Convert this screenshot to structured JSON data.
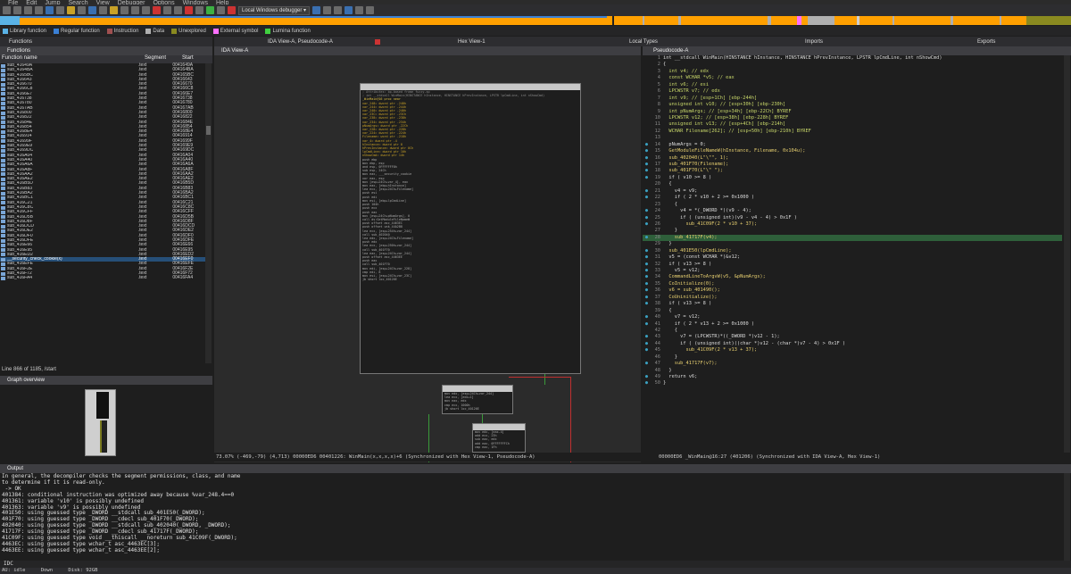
{
  "menu": [
    "File",
    "Edit",
    "Jump",
    "Search",
    "View",
    "Debugger",
    "Options",
    "Windows",
    "Help"
  ],
  "toolbar": {
    "debugger_select": "Local Windows debugger"
  },
  "legend": [
    {
      "label": "Library function",
      "color": "#5ab3e6"
    },
    {
      "label": "Regular function",
      "color": "#3a7fd5"
    },
    {
      "label": "Instruction",
      "color": "#a05050"
    },
    {
      "label": "Data",
      "color": "#b0b0b0"
    },
    {
      "label": "Unexplored",
      "color": "#8a8a20"
    },
    {
      "label": "External symbol",
      "color": "#ff70ff"
    },
    {
      "label": "Lumina function",
      "color": "#40d040"
    }
  ],
  "tabs": {
    "functions": "Functions",
    "ida_pseudo": "IDA View-A, Pseudocode-A",
    "hex": "Hex View-1",
    "local_types": "Local Types",
    "imports": "Imports",
    "exports": "Exports"
  },
  "panes": {
    "ida_view": "IDA View-A",
    "pseudocode": "Pseudocode-A",
    "graph_overview": "Graph overview",
    "output": "Output"
  },
  "functions": {
    "columns": [
      "Function name",
      "Segment",
      "Start"
    ],
    "rows": [
      [
        "sub_41649A",
        ".text",
        "0041649A"
      ],
      [
        "sub_4164BA",
        ".text",
        "004164BA"
      ],
      [
        "sub_4165BC",
        ".text",
        "004165BC"
      ],
      [
        "sub_416643",
        ".text",
        "00416643"
      ],
      [
        "sub_416670",
        ".text",
        "00416670"
      ],
      [
        "sub_4166C8",
        ".text",
        "004166C8"
      ],
      [
        "sub_4166E7",
        ".text",
        "004166E7"
      ],
      [
        "sub_416738",
        ".text",
        "00416738"
      ],
      [
        "sub_416780",
        ".text",
        "00416780"
      ],
      [
        "sub_4167AB",
        ".text",
        "004167AB"
      ],
      [
        "sub_416800",
        ".text",
        "00416800"
      ],
      [
        "sub_416822",
        ".text",
        "00416822"
      ],
      [
        "sub_41684E",
        ".text",
        "0041684E"
      ],
      [
        "sub_416854",
        ".text",
        "00416854"
      ],
      [
        "sub_4168E4",
        ".text",
        "004168E4"
      ],
      [
        "sub_416914",
        ".text",
        "00416914"
      ],
      [
        "sub_41699F",
        ".text",
        "0041699F"
      ],
      [
        "sub_4169E9",
        ".text",
        "004169E9"
      ],
      [
        "sub_4169DC",
        ".text",
        "004169DC"
      ],
      [
        "sub_416A04",
        ".text",
        "00416A04"
      ],
      [
        "sub_416A40",
        ".text",
        "00416A40"
      ],
      [
        "sub_416A6A",
        ".text",
        "00416A6A"
      ],
      [
        "sub_416A8F",
        ".text",
        "00416A8F"
      ],
      [
        "sub_416AA2",
        ".text",
        "00416AA2"
      ],
      [
        "sub_416AE2",
        ".text",
        "00416AE2"
      ],
      [
        "sub_416B5D",
        ".text",
        "00416B5D"
      ],
      [
        "sub_416B83",
        ".text",
        "00416B83"
      ],
      [
        "sub_416BA2",
        ".text",
        "00416BA2"
      ],
      [
        "sub_416BC1",
        ".text",
        "00416BC1"
      ],
      [
        "sub_416C21",
        ".text",
        "00416C21"
      ],
      [
        "sub_416C8C",
        ".text",
        "00416C8C"
      ],
      [
        "sub_416CFF",
        ".text",
        "00416CFF"
      ],
      [
        "sub_416D5B",
        ".text",
        "00416D5B"
      ],
      [
        "sub_416D8F",
        ".text",
        "00416D8F"
      ],
      [
        "sub_416DCD",
        ".text",
        "00416DCD"
      ],
      [
        "sub_416DE2",
        ".text",
        "00416DE2"
      ],
      [
        "sub_416DF0",
        ".text",
        "00416DF0"
      ],
      [
        "sub_416DFE",
        ".text",
        "00416DFE"
      ],
      [
        "sub_416E66",
        ".text",
        "00416E66"
      ],
      [
        "sub_416E95",
        ".text",
        "00416E95"
      ],
      [
        "sub_416ED2",
        ".text",
        "00416ED2"
      ],
      [
        "__security_check_cookie(x)",
        ".text",
        "00416EF0"
      ],
      [
        "sub_416EFE",
        ".text",
        "00416EFE"
      ],
      [
        "sub_416F2E",
        ".text",
        "00416F2E"
      ],
      [
        "sub_416F72",
        ".text",
        "00416F72"
      ],
      [
        "sub_416FA4",
        ".text",
        "00416FA4"
      ]
    ],
    "selected_index": 41
  },
  "line_info": "Line 866 of 1185, /start",
  "ida_status": "73.07% (-469,-79) (4,713) 00000ED6 00401226: WinMain(x,x,x,x)+6 (Synchronized with Hex View-1, Pseudocode-A)",
  "asm_main_block": [
    "; Attributes: bp-based frame fuzzy-sp",
    "",
    "; int __stdcall WinMain(HINSTANCE hInstance, HINSTANCE hPrevInstance, LPSTR lpCmdLine, int nShowCmd)",
    "_WinMain@16 proc near",
    "",
    "var_248= dword ptr -248h",
    "var_244= dword ptr -244h",
    "var_240= dword ptr -240h",
    "var_23C= dword ptr -23Ch",
    "var_238= dword ptr -238h",
    "var_234= dword ptr -234h",
    "pNumArgs= dword ptr -22Ch",
    "var_228= dword ptr -228h",
    "var_224= dword ptr -224h",
    "Filename= word ptr -218h",
    "var_4= dword ptr -4",
    "hInstance= dword ptr  8",
    "hPrevInstance= dword ptr  0Ch",
    "lpCmdLine= dword ptr  10h",
    "nShowCmd= dword ptr  14h",
    "",
    "push    ebp",
    "mov     ebp, esp",
    "and     esp, 0FFFFFFF8h",
    "sub     esp, 24Ch",
    "mov     eax, ___security_cookie",
    "xor     eax, esp",
    "mov     [esp+24Ch+var_4], eax",
    "mov     eax, [ebp+hInstance]",
    "lea     ecx, [esp+24Ch+Filename]",
    "push    esi",
    "push    edi",
    "mov     esi, [ebp+lpCmdLine]",
    "push    104h",
    "push    ecx",
    "push    eax",
    "mov     [esp+24Ch+pNumArgs], 0",
    "call    ds:GetModuleFileNameW",
    "push    offset asc_4463EC",
    "push    offset unk_44A2B8",
    "lea     ecx, [esp+254h+var_244]",
    "call    sub_402040",
    "lea     edx, [esp+24Ch+Filename]",
    "push    edx",
    "lea     ecx, [esp+250h+var_244]",
    "call    sub_401F70",
    "lea     eax, [esp+24Ch+var_244]",
    "push    offset asc_4463EE",
    "push    eax",
    "call    sub_401F70",
    "mov     edi, [esp+24Ch+var_228]",
    "cmp     edi, 8",
    "mov     esi, [esp+24Ch+var_23C]",
    "jb      short loc_40126E"
  ],
  "asm_block2": [
    "mov     edx, [esp+24Ch+var_244]",
    "lea     ecx, [edi+1]",
    "mov     eax, edx",
    "cmp     ecx, 1000h",
    "jb      short loc_40126E"
  ],
  "asm_block3": [
    "mov     edx, [eax-4]",
    "add     ecx, 23h",
    "sub     eax, edx",
    "add     eax, 0FFFFFFFCh",
    "cmp     eax, 1Fh"
  ],
  "pseudocode": [
    {
      "no": "1",
      "dot": false,
      "t": "int __stdcall WinMain(HINSTANCE hInstance, HINSTANCE hPrevInstance, LPSTR lpCmdLine, int nShowCmd)"
    },
    {
      "no": "2",
      "dot": false,
      "t": "{"
    },
    {
      "no": "3",
      "dot": false,
      "t": "  int v4; // edx"
    },
    {
      "no": "4",
      "dot": false,
      "t": "  const WCHAR *v5; // eax"
    },
    {
      "no": "5",
      "dot": false,
      "t": "  int v6; // esi"
    },
    {
      "no": "6",
      "dot": false,
      "t": "  LPCWSTR v7; // edx"
    },
    {
      "no": "7",
      "dot": false,
      "t": "  int v9; // [esp+1Ch] [ebp-244h]"
    },
    {
      "no": "8",
      "dot": false,
      "t": "  unsigned int v10; // [esp+30h] [ebp-230h]"
    },
    {
      "no": "9",
      "dot": false,
      "t": "  int pNumArgs; // [esp+34h] [ebp-22Ch] BYREF"
    },
    {
      "no": "10",
      "dot": false,
      "t": "  LPCWSTR v12; // [esp+38h] [ebp-228h] BYREF"
    },
    {
      "no": "11",
      "dot": false,
      "t": "  unsigned int v13; // [esp+4Ch] [ebp-214h]"
    },
    {
      "no": "12",
      "dot": false,
      "t": "  WCHAR Filename[262]; // [esp+50h] [ebp-210h] BYREF"
    },
    {
      "no": "13",
      "dot": false,
      "t": ""
    },
    {
      "no": "14",
      "dot": true,
      "t": "  pNumArgs = 0;"
    },
    {
      "no": "15",
      "dot": true,
      "t": "  GetModuleFileNameW(hInstance, Filename, 0x104u);"
    },
    {
      "no": "16",
      "dot": true,
      "t": "  sub_402040(L\"\\\"\", 1);"
    },
    {
      "no": "17",
      "dot": true,
      "t": "  sub_401F70(Filename);"
    },
    {
      "no": "18",
      "dot": true,
      "t": "  sub_401F70(L\"\\\" \");"
    },
    {
      "no": "19",
      "dot": true,
      "t": "  if ( v10 >= 8 )"
    },
    {
      "no": "20",
      "dot": false,
      "t": "  {"
    },
    {
      "no": "21",
      "dot": true,
      "t": "    v4 = v9;"
    },
    {
      "no": "22",
      "dot": true,
      "t": "    if ( 2 * v10 + 2 >= 0x1000 )"
    },
    {
      "no": "23",
      "dot": false,
      "t": "    {"
    },
    {
      "no": "24",
      "dot": true,
      "t": "      v4 = *(_DWORD *)(v9 - 4);"
    },
    {
      "no": "25",
      "dot": true,
      "t": "      if ( (unsigned int)(v9 - v4 - 4) > 0x1F )"
    },
    {
      "no": "26",
      "dot": true,
      "t": "        sub_41C09F(2 * v10 + 37);"
    },
    {
      "no": "27",
      "dot": false,
      "t": "    }"
    },
    {
      "no": "28",
      "dot": true,
      "t": "    sub_41717F(v4);",
      "hl": true
    },
    {
      "no": "29",
      "dot": false,
      "t": "  }"
    },
    {
      "no": "30",
      "dot": true,
      "t": "  sub_401E50(lpCmdLine);"
    },
    {
      "no": "31",
      "dot": true,
      "t": "  v5 = (const WCHAR *)&v12;"
    },
    {
      "no": "32",
      "dot": true,
      "t": "  if ( v13 >= 8 )"
    },
    {
      "no": "33",
      "dot": true,
      "t": "    v5 = v12;"
    },
    {
      "no": "34",
      "dot": true,
      "t": "  CommandLineToArgvW(v5, &pNumArgs);"
    },
    {
      "no": "35",
      "dot": true,
      "t": "  CoInitialize(0);"
    },
    {
      "no": "36",
      "dot": true,
      "t": "  v6 = sub_401490();"
    },
    {
      "no": "37",
      "dot": true,
      "t": "  CoUninitialize();"
    },
    {
      "no": "38",
      "dot": true,
      "t": "  if ( v13 >= 8 )"
    },
    {
      "no": "39",
      "dot": false,
      "t": "  {"
    },
    {
      "no": "40",
      "dot": true,
      "t": "    v7 = v12;"
    },
    {
      "no": "41",
      "dot": true,
      "t": "    if ( 2 * v13 + 2 >= 0x1000 )"
    },
    {
      "no": "42",
      "dot": false,
      "t": "    {"
    },
    {
      "no": "43",
      "dot": true,
      "t": "      v7 = (LPCWSTR)*((_DWORD *)v12 - 1);"
    },
    {
      "no": "44",
      "dot": true,
      "t": "      if ( (unsigned int)((char *)v12 - (char *)v7 - 4) > 0x1F )"
    },
    {
      "no": "45",
      "dot": true,
      "t": "        sub_41C09F(2 * v13 + 37);"
    },
    {
      "no": "46",
      "dot": false,
      "t": "    }"
    },
    {
      "no": "47",
      "dot": true,
      "t": "    sub_41717F(v7);"
    },
    {
      "no": "48",
      "dot": false,
      "t": "  }"
    },
    {
      "no": "49",
      "dot": true,
      "t": "  return v6;"
    },
    {
      "no": "50",
      "dot": true,
      "t": "}"
    }
  ],
  "pseudo_status": "00000ED6 _WinMain@16:27 (401206) (Synchronized with IDA View-A, Hex View-1)",
  "output_lines": [
    "In general, the decompiler checks the segment permissions, class, and name",
    "to determine if it is read-only.",
    " -> OK",
    "401384: conditional instruction was optimized away because %var_248.4==0",
    "401361: variable 'v10' is possibly undefined",
    "401363: variable 'v9' is possibly undefined",
    "401E50: using guessed type _DWORD __stdcall sub_401E50(_DWORD);",
    "401F70: using guessed type _DWORD __cdecl sub_401F70(_DWORD);",
    "402040: using guessed type _DWORD __stdcall sub_402040(_DWORD, _DWORD);",
    "41717F: using guessed type _DWORD __cdecl sub_41717F(_DWORD);",
    "41C09F: using guessed type void __thiscall __noreturn sub_41C09F(_DWORD);",
    "4463EC: using guessed type wchar_t asc_4463EC[3];",
    "4463EE: using guessed type wchar_t asc_4463EE[2];"
  ],
  "cmd_label": "IDC",
  "status": {
    "state": "AU:  idle",
    "direction": "Down",
    "disk": "Disk: 92GB"
  }
}
